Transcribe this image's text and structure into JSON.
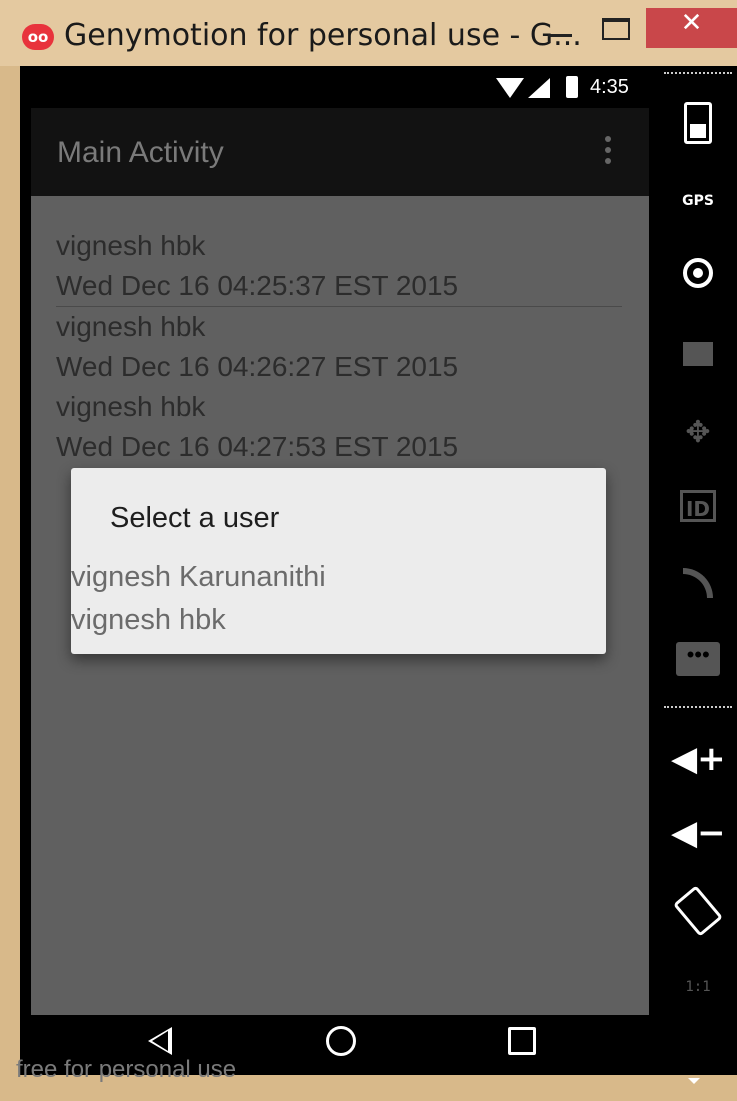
{
  "window": {
    "title": "Genymotion for personal use - G...",
    "icon_text": "oo",
    "close_glyph": "✕"
  },
  "status_bar": {
    "time": "4:35",
    "icons": [
      "wifi-icon",
      "signal-icon",
      "battery-icon"
    ]
  },
  "app": {
    "title": "Main Activity",
    "entries": [
      {
        "name": "vignesh hbk",
        "date": "Wed Dec 16 04:25:37 EST 2015"
      },
      {
        "name": "vignesh hbk",
        "date": "Wed Dec 16 04:26:27 EST 2015"
      },
      {
        "name": "vignesh hbk",
        "date": "Wed Dec 16 04:27:53 EST 2015"
      }
    ]
  },
  "dialog": {
    "title": "Select a user",
    "options": [
      "vignesh Karunanithi",
      "vignesh hbk"
    ]
  },
  "nav_bar": {
    "icons": [
      "back-icon",
      "home-icon",
      "recent-apps-icon"
    ]
  },
  "watermark": "free for personal use",
  "sidebar": {
    "gps_label": "GPS",
    "id_label": "ID",
    "message_glyph": "•••",
    "dpad_glyph": "✥",
    "volume_up_glyph": "◀+",
    "volume_down_glyph": "◀−",
    "pixel_label": "1:1",
    "icons": [
      "battery-icon",
      "gps-icon",
      "webcam-icon",
      "clapper-icon",
      "dpad-icon",
      "id-icon",
      "rss-icon",
      "message-icon",
      "volume-up-icon",
      "volume-down-icon",
      "rotate-icon",
      "pixel-perfect-icon"
    ]
  },
  "colors": {
    "frame": "#d8b98a",
    "close": "#c9474a",
    "content_bg": "#606060",
    "dialog_bg": "#ececec"
  }
}
